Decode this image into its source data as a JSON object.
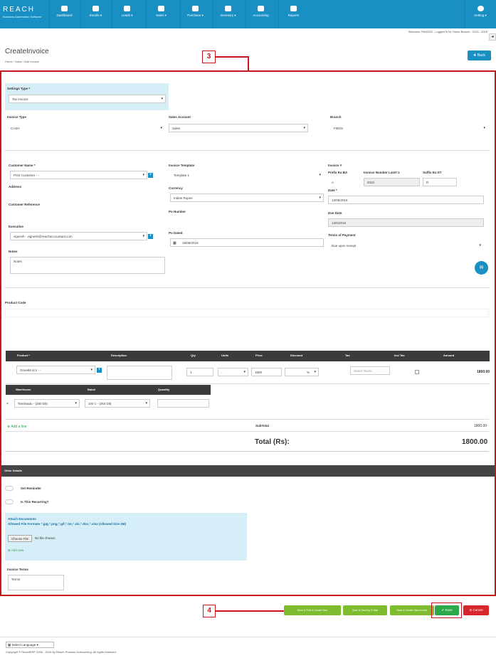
{
  "brand": {
    "logo": "REACH",
    "tagline": "Business Automation Software"
  },
  "nav": [
    {
      "label": "Dashboard",
      "icon": "dashboard-icon"
    },
    {
      "label": "Enrolls",
      "icon": "enroll-icon"
    },
    {
      "label": "Leads",
      "icon": "leads-icon"
    },
    {
      "label": "Sales",
      "icon": "sales-icon"
    },
    {
      "label": "Purchase",
      "icon": "purchase-icon"
    },
    {
      "label": "Inventory",
      "icon": "inventory-icon"
    },
    {
      "label": "Accounting",
      "icon": "calculator-icon"
    },
    {
      "label": "Reports",
      "icon": "reports-icon"
    }
  ],
  "settings_label": "Setting",
  "welcome": "Welcome FAMOSZ , Logged in for Home Branch : 2015 - 2016",
  "page_title": "CreateInvoice",
  "breadcrumb": "Home / Sales / Add Invoice",
  "back_label": "Back",
  "callouts": {
    "form": "3",
    "buttons": "4"
  },
  "settings_type": {
    "label": "Settings Type *",
    "value": "Tax Invoice"
  },
  "invoice_type": {
    "label": "Invoice Type",
    "value": "CASH"
  },
  "sales_account": {
    "label": "Sales Account",
    "value": "Sales"
  },
  "branch": {
    "label": "Branch",
    "value": "FMOS"
  },
  "customer": {
    "label": "Customer Name *",
    "value": "POS Customer - -"
  },
  "address_label": "Address",
  "customer_ref_label": "Customer Reference",
  "executive": {
    "label": "Executive",
    "value": "vignesh - vignesh@reachaccountant.com"
  },
  "notes": {
    "label": "Notes",
    "value": "Notes"
  },
  "invoice_template": {
    "label": "Invoice Template",
    "value": "Template 1"
  },
  "currency": {
    "label": "Currency",
    "value": "Indian Rupee"
  },
  "po_number_label": "Po Number",
  "po_date": {
    "label": "Po Dated",
    "value": "18/05/2016"
  },
  "invoice_no": {
    "label": "Invoice #",
    "prefix_label": "Prefix Ex:BA",
    "prefix": "A",
    "number_label": "Invoice Number Last#:1",
    "number": "9322",
    "suffix_label": "Suffix Ex:ST",
    "suffix": "R"
  },
  "date": {
    "label": "Date *",
    "value": "13/05/2016"
  },
  "due_date": {
    "label": "Due Date",
    "value": "13/5/2016"
  },
  "terms_of_payment": {
    "label": "Terms of Payment",
    "value": "Due upon receipt"
  },
  "product_code_label": "Product Code",
  "item_columns": [
    "Product *",
    "Description",
    "Qty",
    "Units",
    "Price",
    "Discount",
    "Tax",
    "Incl Tax",
    "Amount"
  ],
  "item_row": {
    "product": "Gravel8 4cn - -",
    "qty": "1",
    "units": "-",
    "price": "1800",
    "discount": "%",
    "tax_placeholder": "Select Taxes",
    "amount": "1800.00"
  },
  "warehouse_columns": [
    "Warehouse",
    "Batch",
    "Quantity"
  ],
  "warehouse_row": {
    "warehouse": "Tamilnadu - (250 Dlt)",
    "batch": "100 1 - (250 Dlt)"
  },
  "add_line": "Add a line",
  "subtotal": {
    "label": "SubTotal",
    "value": "1800.00"
  },
  "total": {
    "label": "Total (Rs):",
    "value": "1800.00"
  },
  "other_details": "Other Details",
  "set_reminder": "Set Reminder",
  "recurring": "Is This Recurring?",
  "attach": {
    "title": "Attach Documents",
    "formats": "Allowed File Formats \".jpg,\".png,\".gif,\".txt,\".xls,\".doc,\".xlsx (Allowed Size 2M)",
    "choose": "Choose File",
    "nofile": "No file chosen",
    "add_new": "Add new"
  },
  "invoice_terms": {
    "label": "Invoice Terms",
    "value": "Terms"
  },
  "bottom_buttons": [
    "Save & Print & Create New",
    "Save & Send by E-Mail",
    "Save & Create New Invoice"
  ],
  "save_label": "Save",
  "cancel_label": "Cancel",
  "language": "Select Language",
  "copyright": "Copyright © ReachERP 2006 - 2016 by Reach Process Outsourcing. All rights reserved."
}
